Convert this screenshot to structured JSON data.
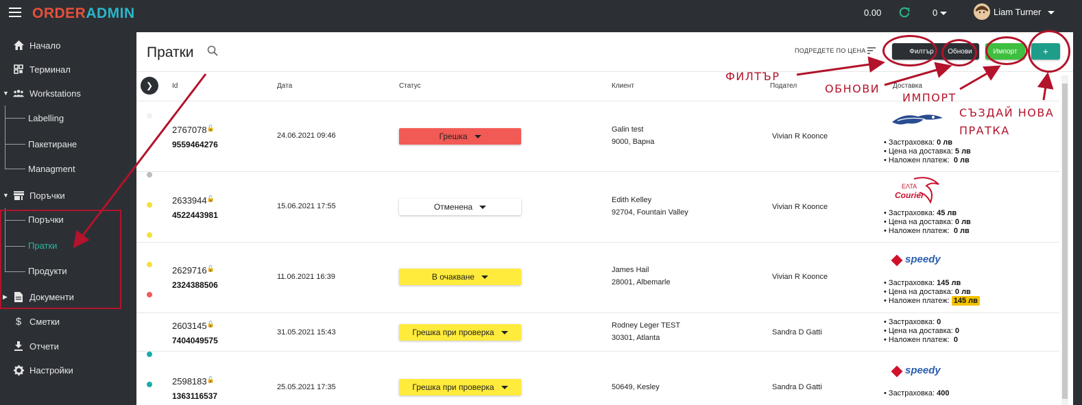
{
  "app": {
    "logo_part1": "ORDER",
    "logo_part2": "ADMIN",
    "balance": "0.00",
    "counter": "0",
    "user_name": "Liam Turner"
  },
  "sidebar": {
    "items": [
      {
        "label": "Начало",
        "icon": "home-icon"
      },
      {
        "label": "Терминал",
        "icon": "qr-icon"
      },
      {
        "label": "Workstations",
        "icon": "group-icon"
      },
      {
        "label": "Labelling"
      },
      {
        "label": "Пакетиране"
      },
      {
        "label": "Managment"
      },
      {
        "label": "Поръчки",
        "icon": "store-icon"
      },
      {
        "label": "Поръчки"
      },
      {
        "label": "Пратки"
      },
      {
        "label": "Продукти"
      },
      {
        "label": "Документи",
        "icon": "document-icon"
      },
      {
        "label": "Сметки",
        "icon": "dollar-icon"
      },
      {
        "label": "Отчети",
        "icon": "download-icon"
      },
      {
        "label": "Настройки",
        "icon": "gear-icon"
      }
    ],
    "active_color": "#2bb5a0"
  },
  "page": {
    "title": "Пратки",
    "sort_label": "ПОДРЕДЕТЕ ПО ЦЕНА"
  },
  "buttons": {
    "filter": "Филтър",
    "refresh": "Обнови",
    "import": "Импорт",
    "create": "+"
  },
  "annotations": {
    "filter": "ФИЛТЪР",
    "refresh": "ОБНОВИ",
    "import": "ИМПОРТ",
    "create_line1": "СЪЗДАЙ НОВА",
    "create_line2": "ПРАТКА"
  },
  "table": {
    "headers": {
      "id": "Id",
      "date": "Дата",
      "status": "Статус",
      "client": "Клиент",
      "sender": "Подател",
      "delivery": "Доставка"
    },
    "rows": [
      {
        "id": "2767078",
        "tracking": "9559464276",
        "date": "24.06.2021 09:46",
        "status": "Грешка",
        "status_color": "#f25a55",
        "client_name": "Galin test",
        "client_addr": "9000, Варна",
        "sender": "Vivian R Koonce",
        "courier": "Econt",
        "insurance_label": "Застраховка:",
        "insurance": "0 лв",
        "delivery_label": "Цена на доставка:",
        "delivery_price": "5 лв",
        "cod_label": "Наложен платеж:",
        "cod": "0 лв"
      },
      {
        "id": "2633944",
        "tracking": "4522443981",
        "date": "15.06.2021 17:55",
        "status": "Отменена",
        "status_color": "#ffffff",
        "client_name": "Edith Kelley",
        "client_addr": "92704, Fountain Valley",
        "sender": "Vivian R Koonce",
        "courier": "ELTA Courier",
        "insurance_label": "Застраховка:",
        "insurance": "45 лв",
        "delivery_label": "Цена на доставка:",
        "delivery_price": "0 лв",
        "cod_label": "Наложен платеж:",
        "cod": "0 лв"
      },
      {
        "id": "2629716",
        "tracking": "2324388506",
        "date": "11.06.2021 16:39",
        "status": "В очакване",
        "status_color": "#ffeb3b",
        "client_name": "James Hail",
        "client_addr": "28001, Albemarle",
        "sender": "Vivian R Koonce",
        "courier": "speedy",
        "insurance_label": "Застраховка:",
        "insurance": "145 лв",
        "delivery_label": "Цена на доставка:",
        "delivery_price": "0 лв",
        "cod_label": "Наложен платеж:",
        "cod": "145 лв"
      },
      {
        "id": "2603145",
        "tracking": "7404049575",
        "date": "31.05.2021 15:43",
        "status": "Грешка при проверка",
        "status_color": "#ffeb3b",
        "client_name": "Rodney Leger TEST",
        "client_addr": "30301, Atlanta",
        "sender": "Sandra D Gatti",
        "courier": "",
        "insurance_label": "Застраховка:",
        "insurance": "0",
        "delivery_label": "Цена на доставка:",
        "delivery_price": "0",
        "cod_label": "Наложен платеж:",
        "cod": "0"
      },
      {
        "id": "2598183",
        "tracking": "1363116537",
        "date": "25.05.2021 17:35",
        "status": "Грешка при проверка",
        "status_color": "#ffeb3b",
        "client_name": "",
        "client_addr": "50649, Kesley",
        "sender": "Sandra D Gatti",
        "courier": "speedy",
        "insurance_label": "Застраховка:",
        "insurance": "400"
      }
    ]
  },
  "colors": {
    "brand_red": "#e8503a",
    "brand_blue": "#2bb5c8",
    "annotation": "#b3132b",
    "filter_btn": "#2c3035",
    "import_btn": "#3fbf3f",
    "create_btn": "#1e9e8a"
  }
}
